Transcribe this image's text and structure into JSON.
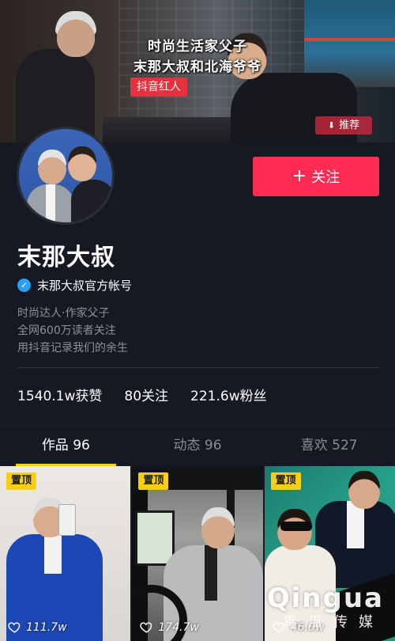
{
  "cover": {
    "caption_line1": "时尚生活家父子",
    "caption_line2": "末那大叔和北海爷爷",
    "tag": "抖音红人",
    "recommend_label": "推荐",
    "recommend_icon": "arrow-down-icon"
  },
  "profile": {
    "follow_label": "关注",
    "nickname": "末那大叔",
    "verified_label": "末那大叔官方帐号",
    "bio": [
      "时尚达人·作家父子",
      "全网600万读者关注",
      "用抖音记录我们的余生"
    ]
  },
  "stats": {
    "likes": "1540.1w获赞",
    "following": "80关注",
    "followers": "221.6w粉丝"
  },
  "tabs": [
    {
      "label": "作品 96",
      "active": true
    },
    {
      "label": "动态 96",
      "active": false
    },
    {
      "label": "喜欢 527",
      "active": false
    }
  ],
  "videos": [
    {
      "pin": "置顶",
      "likes": "111.7w"
    },
    {
      "pin": "置顶",
      "likes": "174.7w"
    },
    {
      "pin": "置顶",
      "likes": "46.0w"
    }
  ],
  "watermark": {
    "brand": "Qingua",
    "brand_cn": "青瓜传媒"
  },
  "colors": {
    "background": "#161823",
    "accent": "#fe2c55",
    "pin": "#face15",
    "verified": "#2a9df4"
  }
}
